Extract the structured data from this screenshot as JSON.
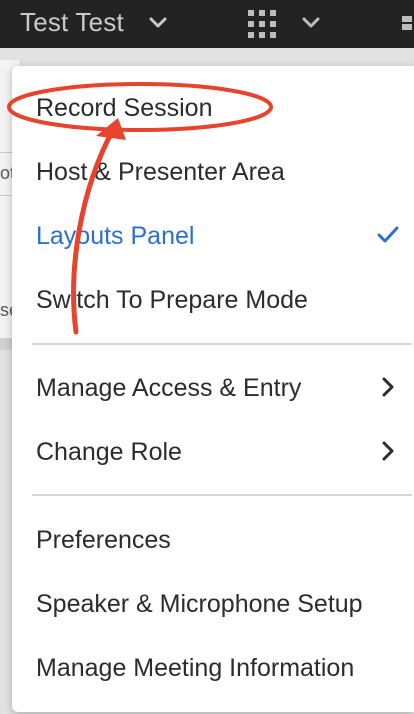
{
  "header": {
    "user_name": "Test Test",
    "user_menu_icon": "chevron-down-icon",
    "apps_icon": "apps-grid-icon",
    "apps_menu_icon": "chevron-down-icon"
  },
  "background": {
    "fragment_1": "ot",
    "fragment_2": "se"
  },
  "menu": {
    "sections": [
      {
        "items": [
          {
            "label": "Record Session",
            "active": false,
            "trailing": null
          },
          {
            "label": "Host & Presenter Area",
            "active": false,
            "trailing": null
          },
          {
            "label": "Layouts Panel",
            "active": true,
            "trailing": "checkmark-icon"
          },
          {
            "label": "Switch To Prepare Mode",
            "active": false,
            "trailing": null
          }
        ]
      },
      {
        "items": [
          {
            "label": "Manage Access & Entry",
            "active": false,
            "trailing": "chevron-right-icon"
          },
          {
            "label": "Change Role",
            "active": false,
            "trailing": "chevron-right-icon"
          }
        ]
      },
      {
        "items": [
          {
            "label": "Preferences",
            "active": false,
            "trailing": null
          },
          {
            "label": "Speaker & Microphone Setup",
            "active": false,
            "trailing": null
          },
          {
            "label": "Manage Meeting Information",
            "active": false,
            "trailing": null
          }
        ]
      }
    ]
  },
  "colors": {
    "topbar": "#232323",
    "active_item": "#2c6fd1",
    "annotation": "#e8432d"
  },
  "annotation": {
    "type": "circle-and-arrow",
    "target": "Record Session"
  }
}
